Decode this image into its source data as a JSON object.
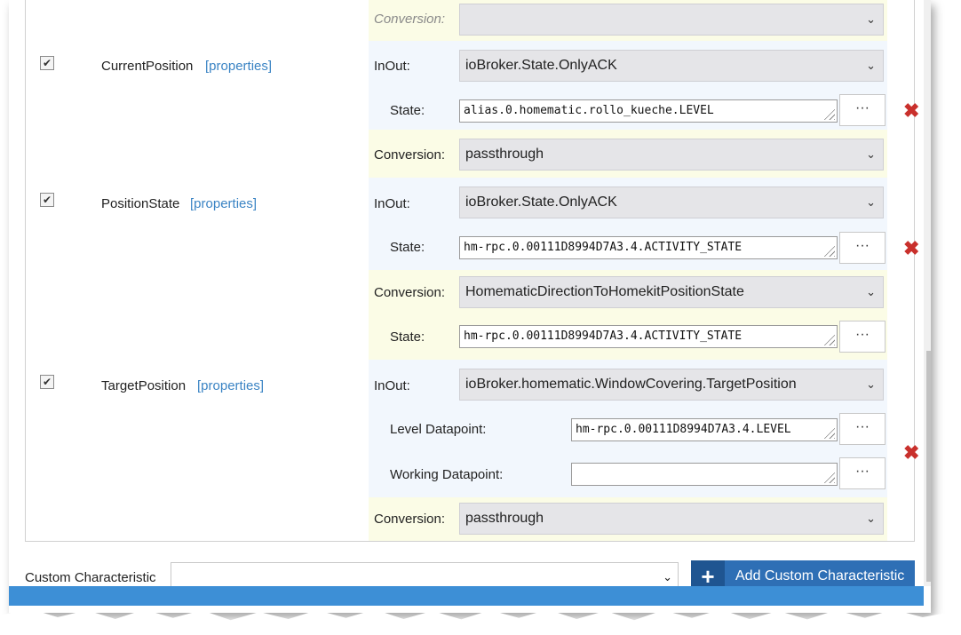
{
  "top_row": {
    "conversion_label": "Conversion:"
  },
  "characteristics": [
    {
      "name": "CurrentPosition",
      "properties_link": "[properties]",
      "checked": true,
      "inout_label": "InOut:",
      "inout_value": "ioBroker.State.OnlyACK",
      "fields": [
        {
          "label": "State:",
          "value": "alias.0.homematic.rollo_kueche.LEVEL"
        }
      ],
      "conversion_label": "Conversion:",
      "conversion_value": "passthrough"
    },
    {
      "name": "PositionState",
      "properties_link": "[properties]",
      "checked": true,
      "inout_label": "InOut:",
      "inout_value": "ioBroker.State.OnlyACK",
      "fields": [
        {
          "label": "State:",
          "value": "hm-rpc.0.00111D8994D7A3.4.ACTIVITY_STATE"
        }
      ],
      "conversion_label": "Conversion:",
      "conversion_value": "HomematicDirectionToHomekitPositionState",
      "conversion_fields": [
        {
          "label": "State:",
          "value": "hm-rpc.0.00111D8994D7A3.4.ACTIVITY_STATE"
        }
      ]
    },
    {
      "name": "TargetPosition",
      "properties_link": "[properties]",
      "checked": true,
      "inout_label": "InOut:",
      "inout_value": "ioBroker.homematic.WindowCovering.TargetPosition",
      "fields": [
        {
          "label": "Level Datapoint:",
          "value": "hm-rpc.0.00111D8994D7A3.4.LEVEL"
        },
        {
          "label": "Working Datapoint:",
          "value": ""
        }
      ],
      "conversion_label": "Conversion:",
      "conversion_value": "passthrough"
    }
  ],
  "footer": {
    "custom_label": "Custom Characteristic",
    "custom_select_value": "",
    "add_button_label": "Add Custom Characteristic"
  },
  "icons": {
    "check": "✔",
    "dots": "···",
    "delete": "✖",
    "chevron": "⌄",
    "plus": "+"
  },
  "colors": {
    "accent": "#3b84c4",
    "delete": "#c9302c",
    "button": "#2e6fb5"
  }
}
